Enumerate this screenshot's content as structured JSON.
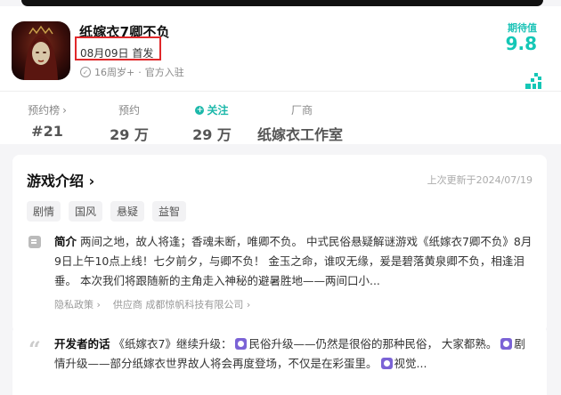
{
  "game": {
    "title": "纸嫁衣7卿不负",
    "release": "08月09日 首发",
    "age": "16周岁+",
    "official": "官方入驻",
    "rating_label": "期待值",
    "rating_value": "9.8"
  },
  "stats": {
    "rank_label": "预约榜",
    "rank_value": "#21",
    "reserve_label": "预约",
    "reserve_value": "29 万",
    "follow_label": "关注",
    "follow_value": "29 万",
    "vendor_label": "厂商",
    "vendor_value": "纸嫁衣工作室"
  },
  "intro": {
    "title": "游戏介绍",
    "updated": "上次更新于2024/07/19",
    "tags": [
      "剧情",
      "国风",
      "悬疑",
      "益智"
    ],
    "heading": "简介",
    "text": "两间之地，故人将逢；香魂未断，唯卿不负。 中式民俗悬疑解谜游戏《纸嫁衣7卿不负》8月9日上午10点上线！七夕前夕，与卿不负！ 金玉之命，谁叹无缘，爰是碧落黄泉卿不负，相逢泪垂。 本次我们将跟随新的主角走入神秘的避暑胜地——两间口小...",
    "privacy": "隐私政策",
    "supplier": "供应商 成都惊帆科技有限公司"
  },
  "developer": {
    "heading": "开发者的话",
    "t1": "《纸嫁衣7》继续升级：",
    "t2": "民俗升级——仍然是很俗的那种民俗， 大家都熟。",
    "t3": "剧情升级——部分纸嫁衣世界故人将会再度登场，不仅是在彩蛋里。",
    "t4": "视觉..."
  },
  "colors": {
    "accent": "#1cb8aa",
    "highlight_box": "#e0282a"
  }
}
